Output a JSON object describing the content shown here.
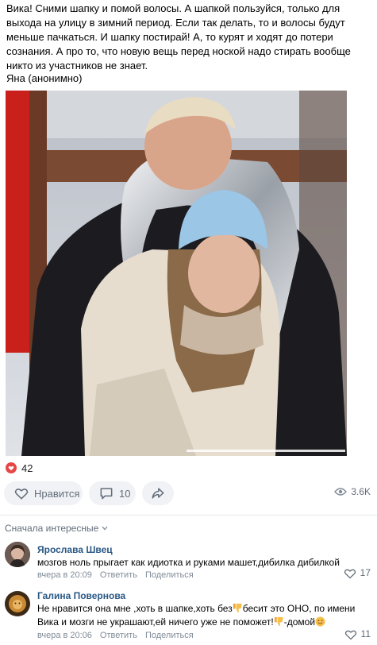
{
  "post": {
    "text": "Вика! Сними шапку и помой волосы. А шапкой пользуйся, только для выхода на улицу в зимний период. Если так делать, то и волосы будут меньше пачкаться. И шапку постирай! А, то курят и ходят до потери сознания. А про то, что новую вещь перед ноской надо стирать вообще никто из участников не знает.",
    "signature": "Яна (анонимно)"
  },
  "reactions": {
    "likes_count": "42",
    "like_button_label": "Нравится",
    "comments_count": "10",
    "views_count": "3.6K"
  },
  "comments_section": {
    "sort_label": "Сначала интересные"
  },
  "comments": [
    {
      "author": "Ярослава Швец",
      "text": "мозгов ноль прыгает как идиотка и руками машет,дибилка дибилкой",
      "time": "вчера в 20:09",
      "reply_label": "Ответить",
      "share_label": "Поделиться",
      "likes": "17"
    },
    {
      "author": "Галина Повернова",
      "text_part1": "Не нравится она мне ,хоть в шапке,хоть без",
      "text_part2": "бесит это ОНО, по имени Вика и мозги не украшают,ей ничего уже не поможет!",
      "text_part3": "-домой",
      "time": "вчера в 20:06",
      "reply_label": "Ответить",
      "share_label": "Поделиться",
      "likes": "11"
    }
  ],
  "colors": {
    "accent": "#2a5885",
    "heart": "#e64646",
    "pill_bg": "#f0f2f5",
    "muted": "#818c99"
  },
  "icons": [
    "heart-icon",
    "like-outline-icon",
    "comment-icon",
    "share-icon",
    "eye-icon",
    "chevron-down-icon",
    "thumbs-down-emoji",
    "smile-emoji"
  ]
}
